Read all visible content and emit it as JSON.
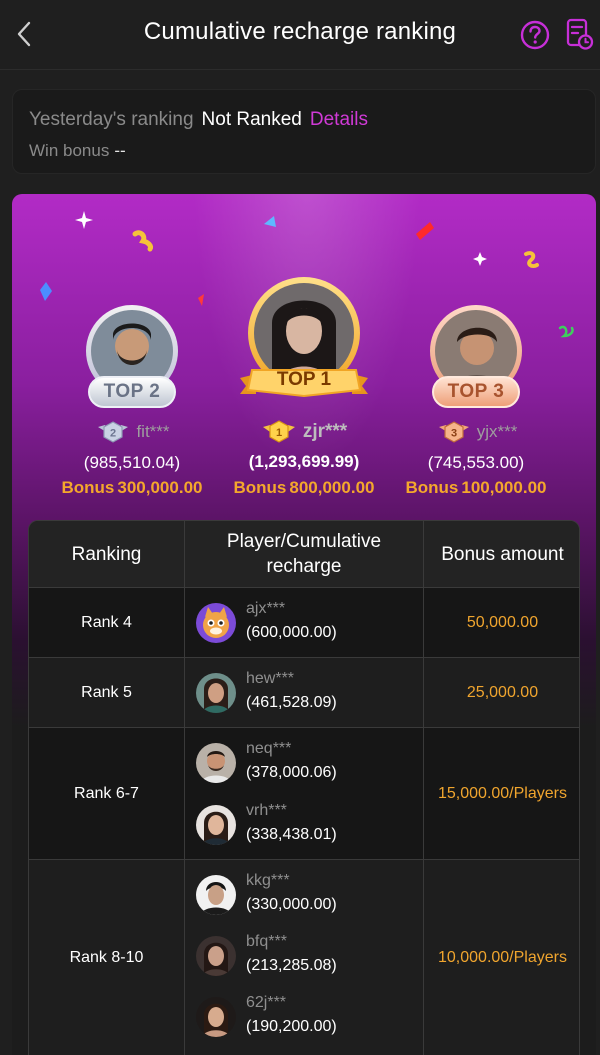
{
  "header": {
    "title": "Cumulative recharge ranking"
  },
  "yesterday": {
    "ranking_label": "Yesterday's ranking",
    "ranking_value": "Not Ranked",
    "details_link": "Details",
    "win_bonus_label": "Win bonus",
    "win_bonus_value": "--"
  },
  "podium": {
    "bonus_word": "Bonus",
    "top": [
      {
        "badge": "TOP 1",
        "medal": "1",
        "name": "zjr***",
        "amount": "(1,293,699.99)",
        "bonus": "800,000.00"
      },
      {
        "badge": "TOP 2",
        "medal": "2",
        "name": "fit***",
        "amount": "(985,510.04)",
        "bonus": "300,000.00"
      },
      {
        "badge": "TOP 3",
        "medal": "3",
        "name": "yjx***",
        "amount": "(745,553.00)",
        "bonus": "100,000.00"
      }
    ]
  },
  "table": {
    "headers": [
      "Ranking",
      "Player/Cumulative recharge",
      "Bonus amount"
    ],
    "rows": [
      {
        "rank": "Rank 4",
        "bonus": "50,000.00",
        "players": [
          {
            "name": "ajx***",
            "amount": "(600,000.00)"
          }
        ]
      },
      {
        "rank": "Rank 5",
        "bonus": "25,000.00",
        "players": [
          {
            "name": "hew***",
            "amount": "(461,528.09)"
          }
        ]
      },
      {
        "rank": "Rank 6-7",
        "bonus": "15,000.00/Players",
        "players": [
          {
            "name": "neq***",
            "amount": "(378,000.06)"
          },
          {
            "name": "vrh***",
            "amount": "(338,438.01)"
          }
        ]
      },
      {
        "rank": "Rank 8-10",
        "bonus": "10,000.00/Players",
        "players": [
          {
            "name": "kkg***",
            "amount": "(330,000.00)"
          },
          {
            "name": "bfq***",
            "amount": "(213,285.08)"
          },
          {
            "name": "62j***",
            "amount": "(190,200.00)"
          }
        ]
      }
    ]
  },
  "colors": {
    "accent": "#d03ad6",
    "gold": "#f4a72c",
    "background": "#1f1f1f"
  },
  "icons": [
    "chevron-left-icon",
    "help-circle-icon",
    "record-clock-icon",
    "medal-icon",
    "avatar"
  ]
}
